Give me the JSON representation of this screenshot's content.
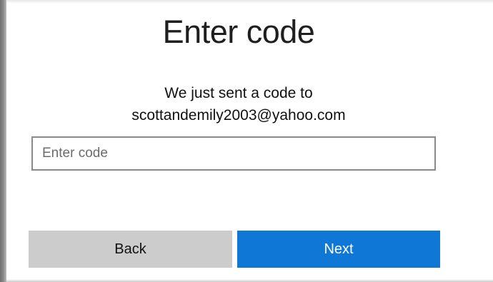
{
  "dialog": {
    "title": "Enter code",
    "message_line1": "We just sent a code to",
    "message_line2": "scottandemily2003@yahoo.com",
    "code_input": {
      "value": "",
      "placeholder": "Enter code"
    },
    "back_label": "Back",
    "next_label": "Next"
  },
  "colors": {
    "primary_button": "#0f78d7",
    "secondary_button": "#cccccc",
    "input_border": "#8a8a8a"
  }
}
